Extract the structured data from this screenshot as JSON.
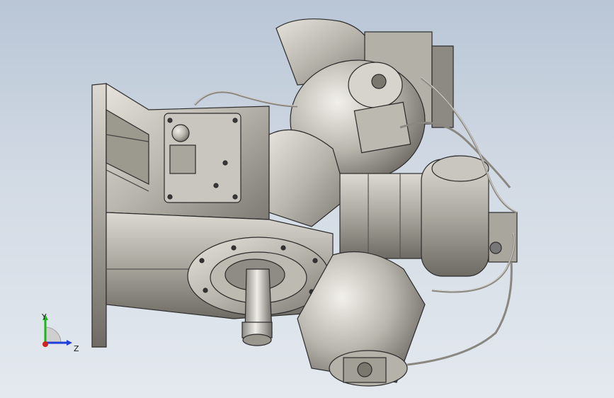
{
  "viewport": {
    "background_top": "#b9c6d6",
    "background_bottom": "#e4e9ef",
    "model_name": "",
    "render_style": "shaded-with-edges"
  },
  "triad": {
    "y_label": "Y",
    "z_label": "Z",
    "x_color": "#d21f1f",
    "y_color": "#1bb51b",
    "z_color": "#1f3fd6",
    "origin_sphere_color": "#cfcfcf"
  }
}
